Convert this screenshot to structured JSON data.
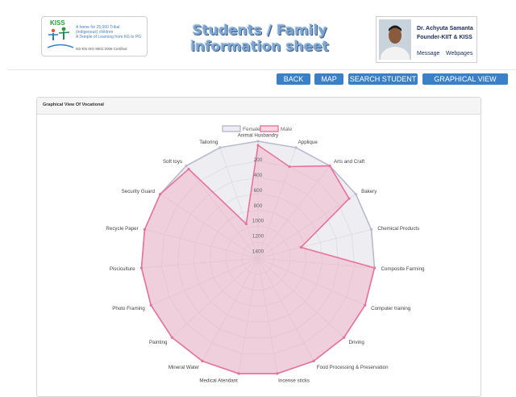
{
  "header": {
    "logo": {
      "brand": "KISS",
      "lines": [
        "A home for 25,000 Tribal",
        "(indigenous) children",
        "A Temple of Learning from KG to PG"
      ],
      "cert": "NS-EN ISO 9001:2008 Certified"
    },
    "title_line1": "Students / Family",
    "title_line2": "information sheet",
    "founder": {
      "name": "Dr. Achyuta Samanta",
      "title": "Founder-KIIT & KISS",
      "message_link": "Message",
      "webpages_link": "Webpages"
    }
  },
  "nav": {
    "back": "BACK",
    "map": "MAP",
    "search_student": "SEARCH STUDENT",
    "graphical_view_tribe": "GRAPHICAL VIEW TRIBE"
  },
  "panel": {
    "title": "Graphical View Of Vocational"
  },
  "colors": {
    "nav_button": "#3a80c9",
    "female_stroke": "#b9b9cf",
    "female_fill": "rgba(220,220,230,0.5)",
    "male_stroke": "#e8739a",
    "male_fill": "rgba(240,170,190,0.45)"
  },
  "chart_data": {
    "type": "radar",
    "legend_position": "top",
    "categories": [
      "Animal Husbandry",
      "Applique",
      "Arts and Craft",
      "Bakery",
      "Chemical Products",
      "Composite Farming",
      "Computer training",
      "Driving",
      "Food Processing & Preservation",
      "Incense sticks",
      "Medical Atendant",
      "Mineral Water",
      "Painting",
      "Photo Framing",
      "Pisciculture",
      "Recycle Paper",
      "Security Guard",
      "Soft toys",
      "Tailoring"
    ],
    "tick_labels": [
      "1400",
      "1200",
      "1000",
      "800",
      "600",
      "400",
      "200"
    ],
    "series": [
      {
        "name": "Female",
        "values": [
          1450,
          1450,
          1450,
          1450,
          1450,
          1450,
          1450,
          1450,
          1450,
          1450,
          1450,
          1450,
          1450,
          1450,
          1450,
          1450,
          1450,
          1450,
          1450
        ]
      },
      {
        "name": "Male",
        "values": [
          1400,
          1200,
          1450,
          1350,
          550,
          1450,
          1450,
          1450,
          1450,
          1450,
          1450,
          1450,
          1450,
          1450,
          1450,
          1450,
          1450,
          1400,
          450
        ]
      }
    ]
  }
}
